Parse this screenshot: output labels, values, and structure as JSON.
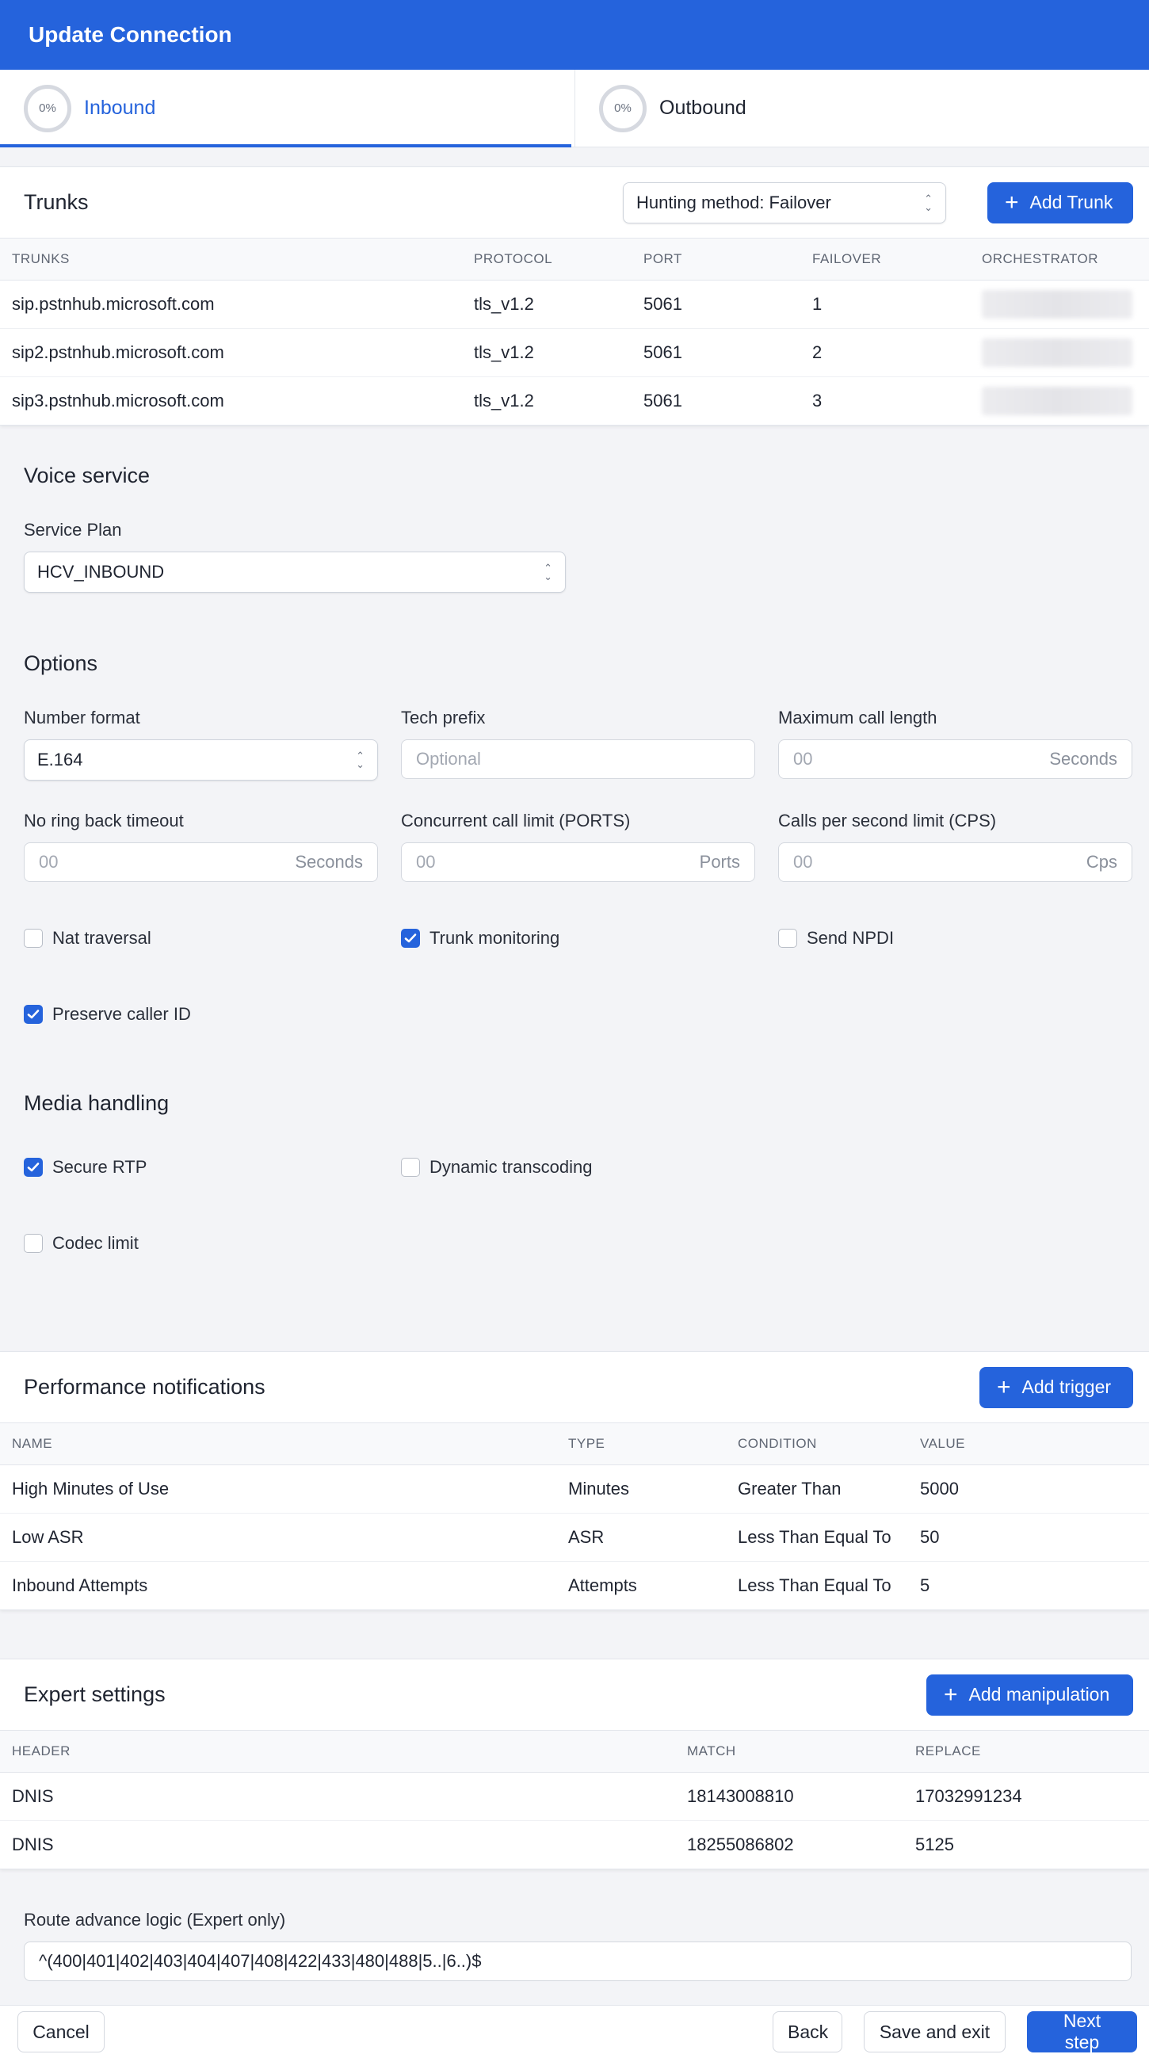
{
  "header": {
    "title": "Update Connection"
  },
  "tabs": [
    {
      "label": "Inbound",
      "progress": "0%"
    },
    {
      "label": "Outbound",
      "progress": "0%"
    }
  ],
  "trunks": {
    "title": "Trunks",
    "hunting_method": "Hunting method: Failover",
    "add_label": "Add Trunk",
    "columns": [
      "TRUNKS",
      "PROTOCOL",
      "PORT",
      "FAILOVER",
      "ORCHESTRATOR"
    ],
    "rows": [
      {
        "trunk": "sip.pstnhub.microsoft.com",
        "protocol": "tls_v1.2",
        "port": "5061",
        "failover": "1"
      },
      {
        "trunk": "sip2.pstnhub.microsoft.com",
        "protocol": "tls_v1.2",
        "port": "5061",
        "failover": "2"
      },
      {
        "trunk": "sip3.pstnhub.microsoft.com",
        "protocol": "tls_v1.2",
        "port": "5061",
        "failover": "3"
      }
    ]
  },
  "voice_service": {
    "title": "Voice service",
    "service_plan_label": "Service Plan",
    "service_plan_value": "HCV_INBOUND"
  },
  "options": {
    "title": "Options",
    "number_format": {
      "label": "Number format",
      "value": "E.164"
    },
    "tech_prefix": {
      "label": "Tech prefix",
      "placeholder": "Optional"
    },
    "max_call_length": {
      "label": "Maximum call length",
      "placeholder": "00",
      "suffix": "Seconds"
    },
    "no_ring_back": {
      "label": "No ring back timeout",
      "placeholder": "00",
      "suffix": "Seconds"
    },
    "concurrent_limit": {
      "label": "Concurrent call limit (PORTS)",
      "placeholder": "00",
      "suffix": "Ports"
    },
    "cps_limit": {
      "label": "Calls per second limit (CPS)",
      "placeholder": "00",
      "suffix": "Cps"
    },
    "nat_traversal": {
      "label": "Nat traversal",
      "checked": false
    },
    "trunk_monitoring": {
      "label": "Trunk monitoring",
      "checked": true
    },
    "send_npdi": {
      "label": "Send NPDI",
      "checked": false
    },
    "preserve_caller_id": {
      "label": "Preserve caller ID",
      "checked": true
    }
  },
  "media": {
    "title": "Media handling",
    "secure_rtp": {
      "label": "Secure RTP",
      "checked": true
    },
    "dynamic_transcoding": {
      "label": "Dynamic transcoding",
      "checked": false
    },
    "codec_limit": {
      "label": "Codec limit",
      "checked": false
    }
  },
  "performance": {
    "title": "Performance notifications",
    "add_label": "Add trigger",
    "columns": [
      "NAME",
      "TYPE",
      "CONDITION",
      "VALUE"
    ],
    "rows": [
      {
        "name": "High Minutes of Use",
        "type": "Minutes",
        "condition": "Greater Than",
        "value": "5000"
      },
      {
        "name": "Low ASR",
        "type": "ASR",
        "condition": "Less Than Equal To",
        "value": "50"
      },
      {
        "name": "Inbound Attempts",
        "type": "Attempts",
        "condition": "Less Than Equal To",
        "value": "5"
      }
    ]
  },
  "expert": {
    "title": "Expert settings",
    "add_label": "Add manipulation",
    "columns": [
      "HEADER",
      "MATCH",
      "REPLACE"
    ],
    "rows": [
      {
        "header": "DNIS",
        "match": "18143008810",
        "replace": "17032991234"
      },
      {
        "header": "DNIS",
        "match": "18255086802",
        "replace": "5125"
      }
    ],
    "route_label": "Route advance logic (Expert only)",
    "route_value": "^(400|401|402|403|404|407|408|422|433|480|488|5..|6..)$"
  },
  "footer": {
    "cancel": "Cancel",
    "back": "Back",
    "save_exit": "Save and exit",
    "next": "Next step"
  },
  "colors": {
    "accent": "#2563dc",
    "background": "#f3f4f7"
  }
}
